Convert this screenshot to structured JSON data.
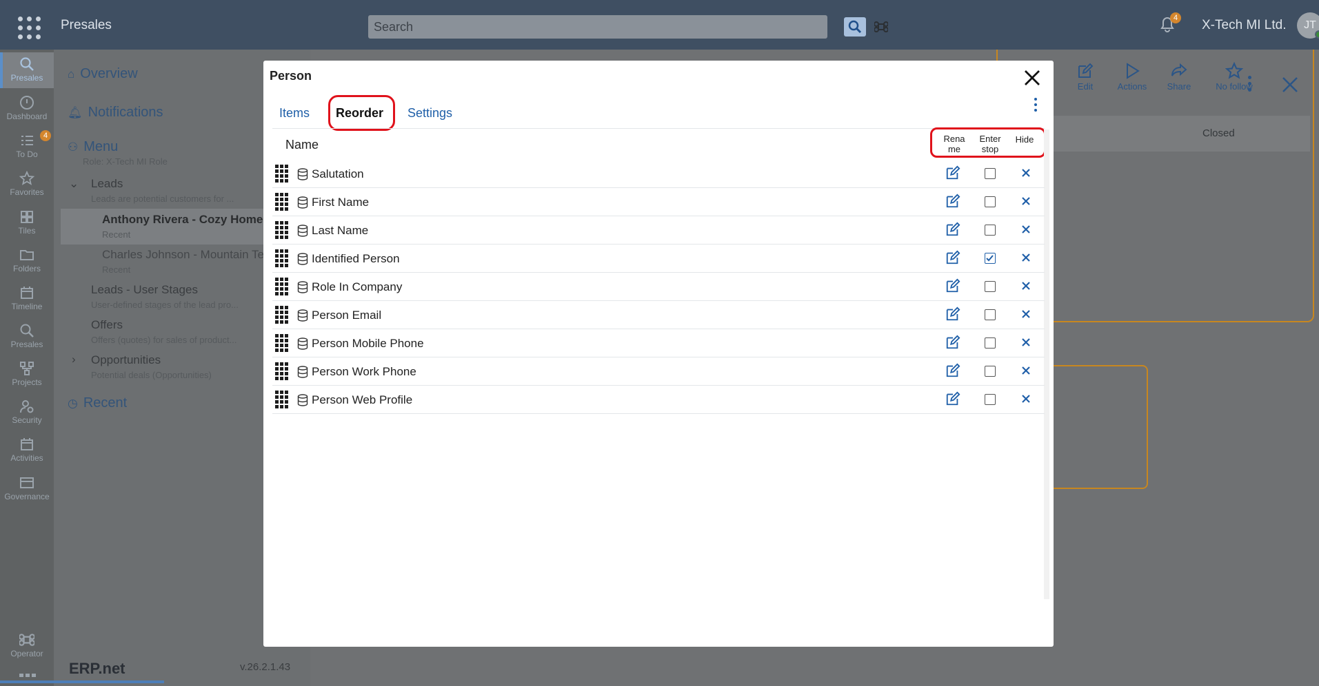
{
  "topbar": {
    "app_title": "Presales",
    "search_placeholder": "Search",
    "company": "X-Tech MI Ltd.",
    "avatar_initials": "JT",
    "notification_count": "4"
  },
  "rail": {
    "items": [
      {
        "label": "Presales",
        "icon": "presales-icon",
        "active": true
      },
      {
        "label": "Dashboard",
        "icon": "dashboard-icon"
      },
      {
        "label": "To Do",
        "icon": "todo-icon",
        "badge": "4"
      },
      {
        "label": "Favorites",
        "icon": "star-icon"
      },
      {
        "label": "Tiles",
        "icon": "tiles-icon"
      },
      {
        "label": "Folders",
        "icon": "folder-icon"
      },
      {
        "label": "Timeline",
        "icon": "timeline-icon"
      },
      {
        "label": "Presales",
        "icon": "presales-icon"
      },
      {
        "label": "Projects",
        "icon": "projects-icon"
      },
      {
        "label": "Security",
        "icon": "security-icon"
      },
      {
        "label": "Activities",
        "icon": "calendar-icon"
      },
      {
        "label": "Governance",
        "icon": "governance-icon"
      }
    ],
    "operator": "Operator"
  },
  "nav": {
    "overview": "Overview",
    "notifications": "Notifications",
    "menu": "Menu",
    "menu_role": "Role: X-Tech MI Role",
    "leads": "Leads",
    "leads_desc": "Leads are potential customers for ...",
    "lead1": "Anthony Rivera - Cozy Homes",
    "lead1_tag": "Recent",
    "lead2": "Charles Johnson - Mountain Te",
    "lead2_tag": "Recent",
    "user_stages": "Leads - User Stages",
    "user_stages_desc": "User-defined stages of the lead pro...",
    "offers": "Offers",
    "offers_desc": "Offers (quotes) for sales of product...",
    "opps": "Opportunities",
    "opps_desc": "Potential deals (Opportunities)",
    "recent": "Recent"
  },
  "footer": {
    "logo_mark": "ERP",
    "logo_text": "ERP.net",
    "version": "v.26.2.1.43"
  },
  "background_toolbar": {
    "edit": "Edit",
    "actions": "Actions",
    "share": "Share",
    "follow": "No follow",
    "stage": "Closed"
  },
  "modal": {
    "title": "Person",
    "tabs": [
      "Items",
      "Reorder",
      "Settings"
    ],
    "columns": {
      "name": "Name",
      "rename_1": "Rena",
      "rename_2": "me",
      "enter_1": "Enter",
      "enter_2": "stop",
      "hide": "Hide"
    },
    "rows": [
      {
        "label": "Salutation",
        "enter_stop": false
      },
      {
        "label": "First Name",
        "enter_stop": false
      },
      {
        "label": "Last Name",
        "enter_stop": false
      },
      {
        "label": "Identified Person",
        "enter_stop": true
      },
      {
        "label": "Role In Company",
        "enter_stop": false
      },
      {
        "label": "Person Email",
        "enter_stop": false
      },
      {
        "label": "Person Mobile Phone",
        "enter_stop": false
      },
      {
        "label": "Person Work Phone",
        "enter_stop": false
      },
      {
        "label": "Person Web Profile",
        "enter_stop": false
      }
    ]
  },
  "colors": {
    "accent": "#1f5fa8",
    "highlight": "#e0121b",
    "topbar": "#3f4f62",
    "orange": "#c8871f"
  }
}
